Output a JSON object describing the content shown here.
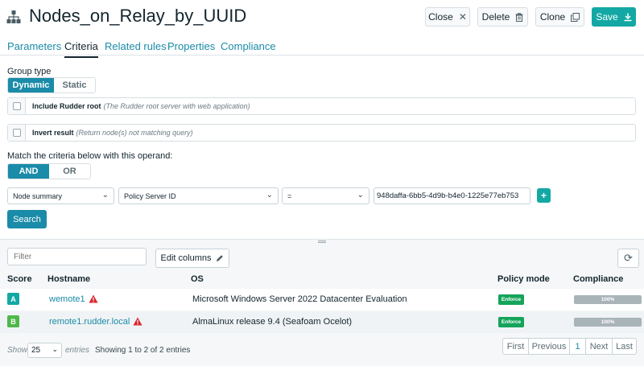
{
  "header": {
    "title": "Nodes_on_Relay_by_UUID",
    "close_label": "Close",
    "delete_label": "Delete",
    "clone_label": "Clone",
    "save_label": "Save"
  },
  "tabs": [
    {
      "label": "Parameters",
      "active": false
    },
    {
      "label": "Criteria",
      "active": true
    },
    {
      "label": "Related rules",
      "active": false
    },
    {
      "label": "Properties",
      "active": false
    },
    {
      "label": "Compliance",
      "active": false
    }
  ],
  "criteria": {
    "group_type_label": "Group type",
    "group_types": [
      "Dynamic",
      "Static"
    ],
    "group_type_selected": "Dynamic",
    "include_root_label": "Include Rudder root",
    "include_root_desc": "(The Rudder root server with web application)",
    "invert_label": "Invert result",
    "invert_desc": "(Return node(s) not matching query)",
    "operand_label": "Match the criteria below with this operand:",
    "operands": [
      "AND",
      "OR"
    ],
    "operand_selected": "AND",
    "line": {
      "object": "Node summary",
      "attribute": "Policy Server ID",
      "comparator": "=",
      "value": "948daffa-6bb5-4d9b-b4e0-1225e77eb753"
    },
    "add_label": "+",
    "search_label": "Search"
  },
  "results": {
    "filter_placeholder": "Filter",
    "edit_columns_label": "Edit columns",
    "columns": [
      "Score",
      "Hostname",
      "OS",
      "Policy mode",
      "Compliance"
    ],
    "rows": [
      {
        "score": "A",
        "score_color": "#13a8a4",
        "hostname": "wemote1",
        "os": "Microsoft Windows Server 2022 Datacenter Evaluation",
        "policy_mode": "Enforce",
        "compliance": "100%"
      },
      {
        "score": "B",
        "score_color": "#4fb84a",
        "hostname": "remote1.rudder.local",
        "os": "AlmaLinux release 9.4 (Seafoam Ocelot)",
        "policy_mode": "Enforce",
        "compliance": "100%"
      }
    ],
    "show_label": "Show",
    "page_size": "25",
    "entries_label": "entries",
    "info": "Showing 1 to 2 of 2 entries",
    "pager": [
      "First",
      "Previous",
      "1",
      "Next",
      "Last"
    ]
  }
}
